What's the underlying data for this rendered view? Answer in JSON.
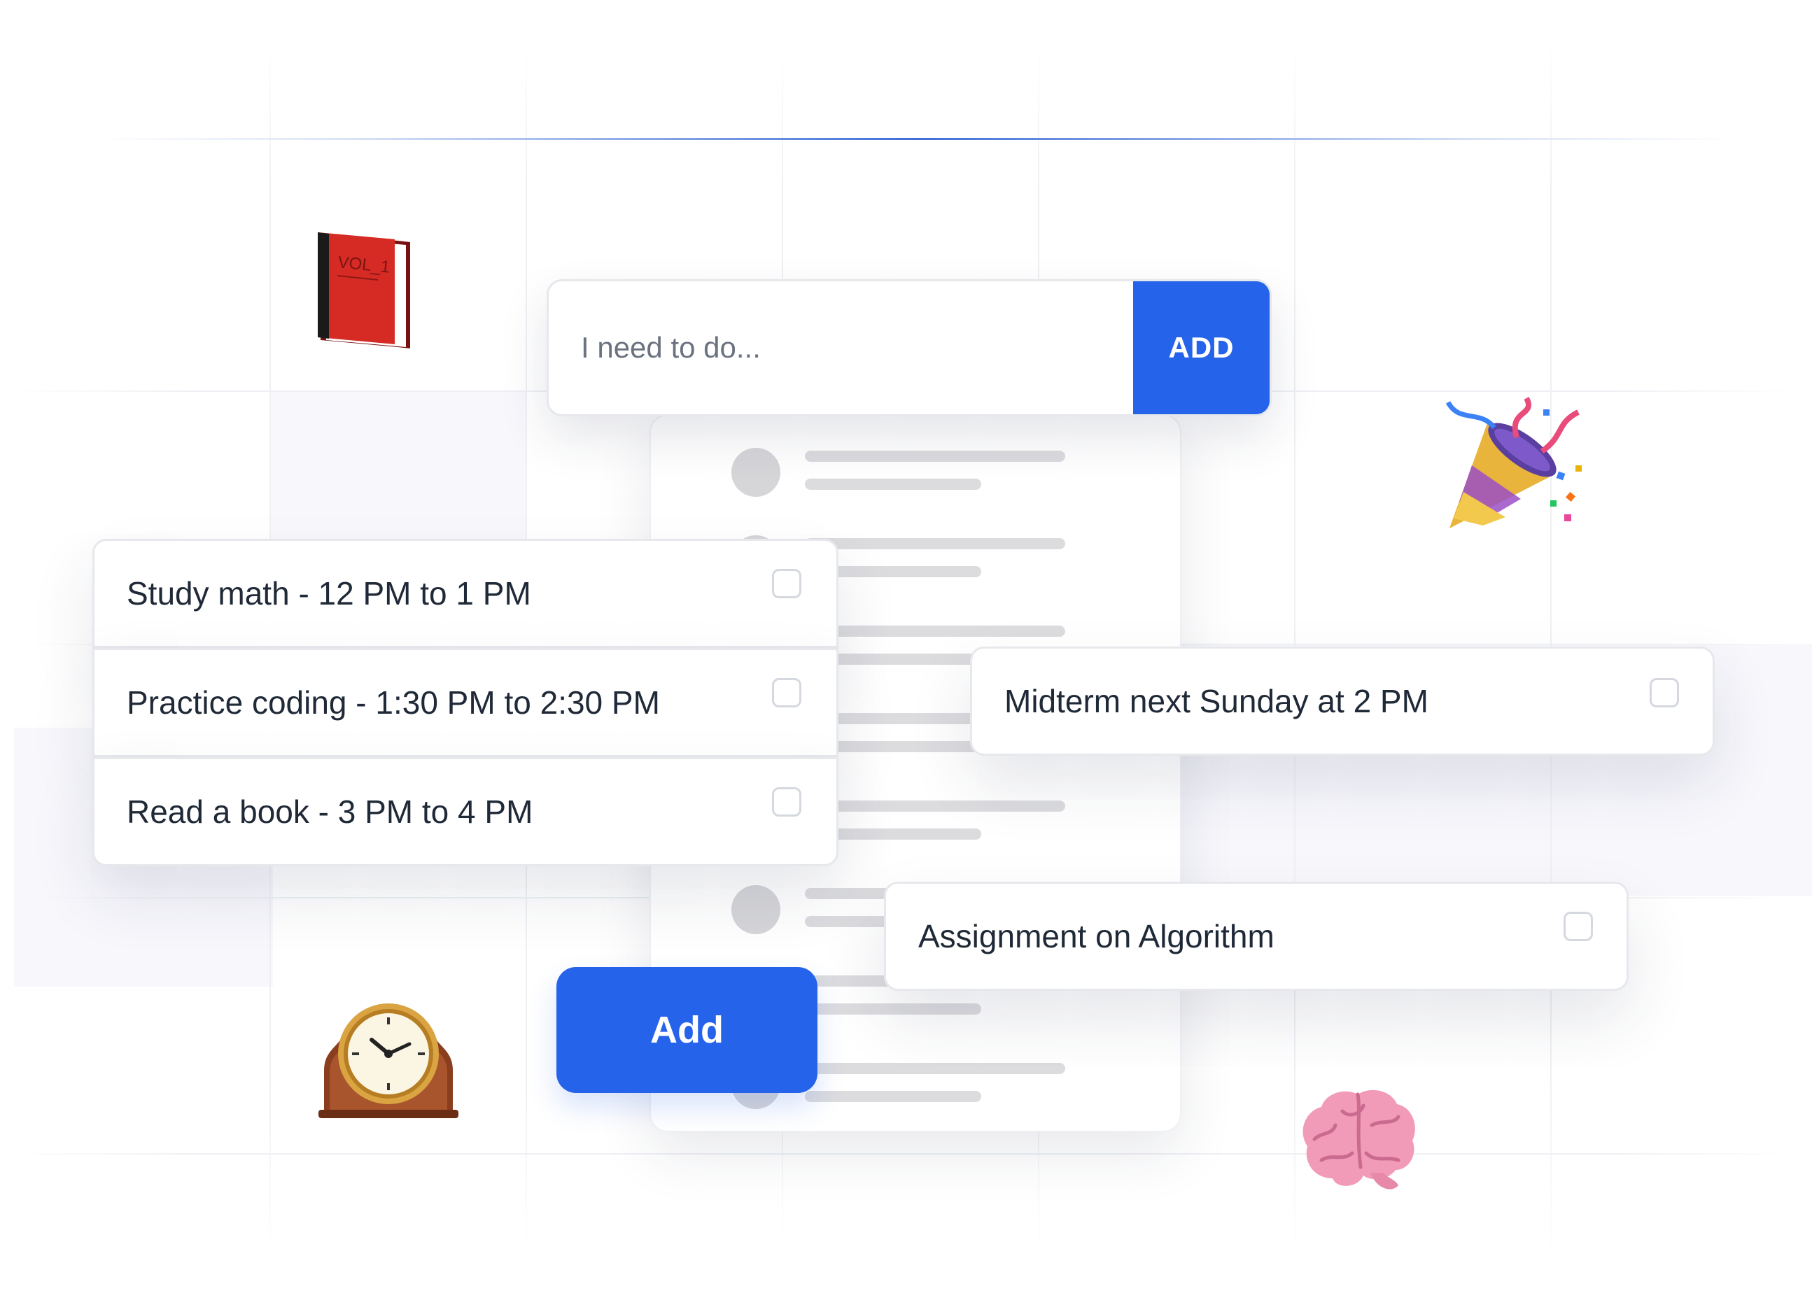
{
  "new_task": {
    "placeholder": "I need to do...",
    "add_label": "ADD"
  },
  "task_list_left": [
    {
      "label": "Study math - 12 PM to 1 PM",
      "checked": false
    },
    {
      "label": "Practice coding - 1:30 PM to 2:30 PM",
      "checked": false
    },
    {
      "label": "Read a book - 3 PM to 4 PM",
      "checked": false
    }
  ],
  "task_midterm": {
    "label": "Midterm next Sunday at 2 PM",
    "checked": false
  },
  "task_assignment": {
    "label": "Assignment on Algorithm",
    "checked": false
  },
  "add_button_label": "Add",
  "book_art": {
    "spine_text": "VOL_1",
    "icon": "book-icon"
  },
  "decorations": {
    "party": "party-popper-icon",
    "clock": "mantel-clock-icon",
    "brain": "brain-icon"
  },
  "colors": {
    "accent": "#2563eb",
    "text": "#1f2937",
    "placeholder": "#6b7280",
    "border": "#e6e8ec"
  }
}
